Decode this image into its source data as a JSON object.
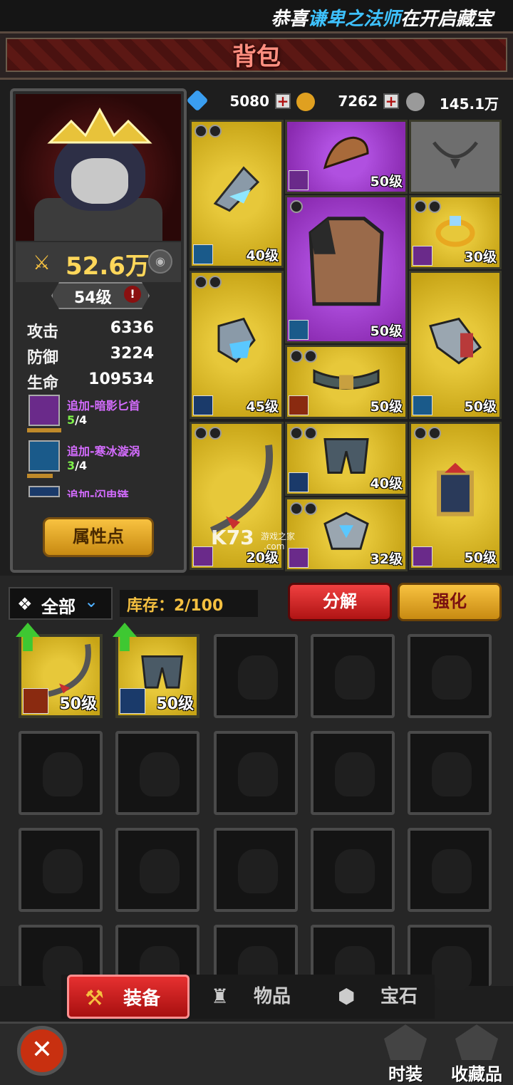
{
  "ticker": {
    "prefix": "恭喜",
    "name": "谦卑之法师",
    "suffix": "在开启藏宝"
  },
  "title": "背包",
  "currency": {
    "diamond": "5080",
    "gold": "7262",
    "silver": "145.1万"
  },
  "hero": {
    "power": "52.6万",
    "level": "54级",
    "stats": [
      {
        "label": "攻击",
        "value": "6336"
      },
      {
        "label": "防御",
        "value": "3224"
      },
      {
        "label": "生命",
        "value": "109534"
      }
    ],
    "skills": [
      {
        "name": "追加-暗影匕首",
        "current": "5",
        "max": "/4",
        "progress": 1.0
      },
      {
        "name": "追加-寒冰漩涡",
        "current": "3",
        "max": "/4",
        "progress": 0.75
      },
      {
        "name": "追加-闪电链",
        "current": "",
        "max": "",
        "progress": 0
      }
    ],
    "attr_button": "属性点"
  },
  "equipped": [
    {
      "slot": "weapon",
      "level": "40级",
      "rarity": "gold",
      "element": "ice"
    },
    {
      "slot": "helmet",
      "level": "50级",
      "rarity": "purple",
      "element": "shadow"
    },
    {
      "slot": "necklace",
      "level": "",
      "rarity": "empty",
      "element": ""
    },
    {
      "slot": "armor",
      "level": "50级",
      "rarity": "purple",
      "element": "ice"
    },
    {
      "slot": "ring",
      "level": "30级",
      "rarity": "gold",
      "element": "shadow"
    },
    {
      "slot": "gloves",
      "level": "45级",
      "rarity": "gold",
      "element": "bolt"
    },
    {
      "slot": "belt",
      "level": "50级",
      "rarity": "gold",
      "element": "fire"
    },
    {
      "slot": "bracer",
      "level": "50级",
      "rarity": "gold",
      "element": "ice"
    },
    {
      "slot": "offhand",
      "level": "20级",
      "rarity": "gold",
      "element": "shadow"
    },
    {
      "slot": "pants",
      "level": "40级",
      "rarity": "gold",
      "element": "bolt"
    },
    {
      "slot": "shoulder",
      "level": "32级",
      "rarity": "gold",
      "element": "shadow"
    },
    {
      "slot": "relic",
      "level": "50级",
      "rarity": "gold",
      "element": "shadow"
    }
  ],
  "watermark": {
    "brand": "K73",
    "sub": "游戏之家",
    "domain": ".com"
  },
  "inventory": {
    "filter": "全部",
    "stock_label": "库存：2/100",
    "decompose": "分解",
    "enhance": "强化",
    "items": [
      {
        "level": "50级",
        "element": "fire",
        "upgrade": true
      },
      {
        "level": "50级",
        "element": "bolt",
        "upgrade": true
      }
    ]
  },
  "tabs": [
    "装备",
    "物品",
    "宝石"
  ],
  "footer": {
    "fashion": "时装",
    "collection": "收藏品"
  },
  "colors": {
    "gold": "#e7c83a",
    "purple": "#b050e0",
    "accent_red": "#e63030",
    "level_yellow": "#ffd75a"
  }
}
